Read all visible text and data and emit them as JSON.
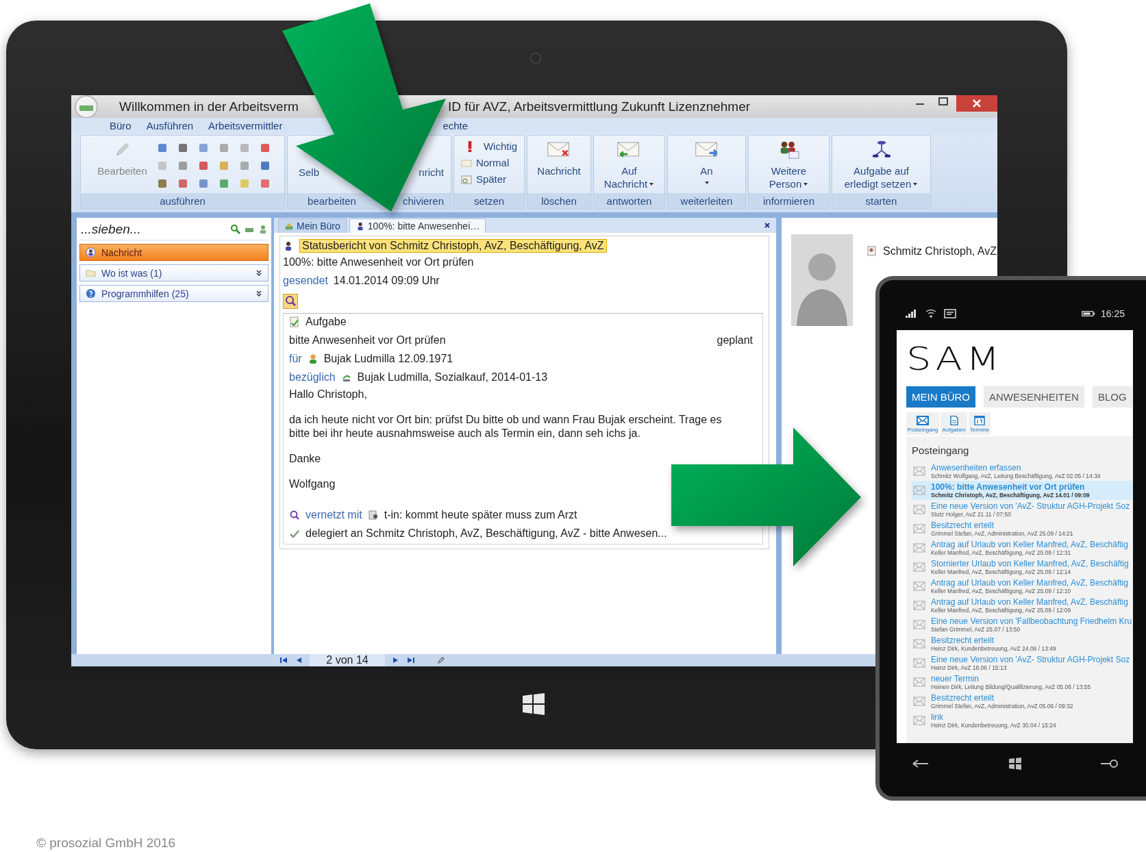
{
  "window": {
    "title_parts": [
      "Willkommen in der Arbeitsverm",
      "ID für AVZ, Arbeitsvermittlung Zukunft Lizenznehmer"
    ]
  },
  "menu": [
    {
      "label": "Büro"
    },
    {
      "label": "Ausführen"
    },
    {
      "label": "Arbeitsvermittler"
    },
    {
      "label": "echte"
    }
  ],
  "ribbon": [
    {
      "label": "ausführen",
      "kind": "tools",
      "buttons": [
        {
          "lines": [
            "Bearbeiten"
          ],
          "disabled": true
        }
      ]
    },
    {
      "label": "bearbeiten",
      "kind": "big",
      "buttons": [
        {
          "lines": [
            "Selb"
          ],
          "disabled": false
        }
      ]
    },
    {
      "label": "chivieren",
      "kind": "big",
      "buttons": [
        {
          "lines": [
            "nricht"
          ],
          "disabled": false
        }
      ]
    },
    {
      "label": "setzen",
      "kind": "list",
      "items": [
        {
          "label": "Wichtig"
        },
        {
          "label": "Normal"
        },
        {
          "label": "Später"
        }
      ]
    },
    {
      "label": "löschen",
      "kind": "big",
      "buttons": [
        {
          "lines": [
            "Nachricht"
          ],
          "disabled": false
        }
      ]
    },
    {
      "label": "antworten",
      "kind": "big",
      "buttons": [
        {
          "lines": [
            "Auf",
            "Nachricht"
          ],
          "disabled": false,
          "dropdown": true
        }
      ]
    },
    {
      "label": "weiterleiten",
      "kind": "big",
      "buttons": [
        {
          "lines": [
            "An"
          ],
          "disabled": false,
          "dropdown": true
        }
      ]
    },
    {
      "label": "informieren",
      "kind": "big",
      "buttons": [
        {
          "lines": [
            "Weitere",
            "Person"
          ],
          "disabled": false,
          "dropdown": true
        }
      ]
    },
    {
      "label": "starten",
      "kind": "big",
      "buttons": [
        {
          "lines": [
            "Aufgabe auf",
            "erledigt setzen"
          ],
          "disabled": false,
          "dropdown": true
        }
      ]
    }
  ],
  "left_panel": {
    "search": {
      "value": "...sieben..."
    },
    "items": [
      {
        "label": "Nachricht",
        "kind": "open",
        "selected": true
      },
      {
        "label": "Wo ist was (1)",
        "kind": "collapsed",
        "selected": false
      },
      {
        "label": "Programmhilfen (25)",
        "kind": "collapsed",
        "selected": false
      }
    ]
  },
  "tabs": [
    {
      "label": "Mein Büro",
      "selected": false
    },
    {
      "label": "100%: bitte Anwesenhei…",
      "selected": true
    }
  ],
  "message": {
    "header": "Statusbericht von Schmitz Christoph, AvZ, Beschäftigung, AvZ",
    "subject": "100%: bitte Anwesenheit vor Ort prüfen",
    "sent_label": "gesendet",
    "sent": "14.01.2014 09:09 Uhr",
    "task": {
      "title": "Aufgabe",
      "text": "bitte Anwesenheit vor Ort prüfen",
      "status": "geplant",
      "for_label": "für",
      "for": "Bujak Ludmilla 12.09.1971",
      "regarding_label": "bezüglich",
      "regarding": "Bujak Ludmilla, Sozialkauf, 2014-01-13"
    },
    "body": [
      "Hallo Christoph,",
      "da ich heute nicht vor Ort bin: prüfst Du bitte ob und wann Frau Bujak erscheint. Trage es bitte bei ihr heute ausnahmsweise auch als Termin ein, dann seh ichs ja.",
      "Danke",
      "Wolfgang"
    ],
    "linked_label": "vernetzt mit",
    "linked": "t-in: kommt heute später muss zum Arzt",
    "delegated": "delegiert an Schmitz Christoph, AvZ, Beschäftigung, AvZ - bitte Anwesen..."
  },
  "pager": {
    "position": "2 von 14"
  },
  "contact": {
    "name": "Schmitz Christoph, AvZ"
  },
  "phone": {
    "time": "16:25",
    "logo": "SAM",
    "tabs": [
      {
        "label": "MEIN BÜRO",
        "selected": true
      },
      {
        "label": "ANWESENHEITEN",
        "selected": false
      },
      {
        "label": "BLOG",
        "selected": false
      }
    ],
    "tiles": [
      {
        "label": "Posteingang"
      },
      {
        "label": "Aufgaben"
      },
      {
        "label": "Termine"
      }
    ],
    "heading": "Posteingang",
    "messages": [
      {
        "title": "Anwesenheiten erfassen",
        "meta": "Schmitz Wolfgang, AvZ, Leitung Beschäftigung, AvZ 02.05 / 14:34",
        "selected": false
      },
      {
        "title": "100%: bitte Anwesenheit vor Ort prüfen",
        "meta": "Schmitz Christoph, AvZ, Beschäftigung, AvZ 14.01 / 09:09",
        "selected": true
      },
      {
        "title": "Eine neue Version von 'AvZ- Struktur AGH-Projekt Soz",
        "meta": "Stutz Holger, AvZ 21.11 / 07:50",
        "selected": false
      },
      {
        "title": "Besitzrecht erteilt",
        "meta": "Grimmel Stefan, AvZ, Administration, AvZ 25.09 / 14:21",
        "selected": false
      },
      {
        "title": "Antrag auf Urlaub von Keller Manfred, AvZ, Beschäftig",
        "meta": "Keller Manfred, AvZ, Beschäftigung, AvZ 25.09 / 12:31",
        "selected": false
      },
      {
        "title": "Stornierter Urlaub von Keller Manfred, AvZ, Beschäftig",
        "meta": "Keller Manfred, AvZ, Beschäftigung, AvZ 25.09 / 12:14",
        "selected": false
      },
      {
        "title": "Antrag auf Urlaub von Keller Manfred, AvZ, Beschäftig",
        "meta": "Keller Manfred, AvZ, Beschäftigung, AvZ 25.09 / 12:10",
        "selected": false
      },
      {
        "title": "Antrag auf Urlaub von Keller Manfred, AvZ, Beschäftig",
        "meta": "Keller Manfred, AvZ, Beschäftigung, AvZ 25.09 / 12:09",
        "selected": false
      },
      {
        "title": "Eine neue Version von 'Fallbeobachtung Friedhelm Kru",
        "meta": "Stefan Grimmel, AvZ 25.07 / 13:50",
        "selected": false
      },
      {
        "title": "Besitzrecht erteilt",
        "meta": "Heinz Dirk, Kundenbetreuung, AvZ 24.06 / 13:49",
        "selected": false
      },
      {
        "title": "Eine neue Version von 'AvZ- Struktur AGH-Projekt Soz",
        "meta": "Heinz Dirk, AvZ 18.06 / 15:13",
        "selected": false
      },
      {
        "title": "neuer Termin",
        "meta": "Heinen Dirk, Leitung Bildung/Qualifizierung, AvZ 05.06 / 13:55",
        "selected": false
      },
      {
        "title": "Besitzrecht erteilt",
        "meta": "Grimmel Stefan, AvZ, Administration, AvZ 05.06 / 09:32",
        "selected": false
      },
      {
        "title": "link",
        "meta": "Heinz Dirk, Kundenbetreuung, AvZ 30.04 / 15:24",
        "selected": false
      }
    ]
  },
  "copyright": "© prosozial GmbH 2016"
}
